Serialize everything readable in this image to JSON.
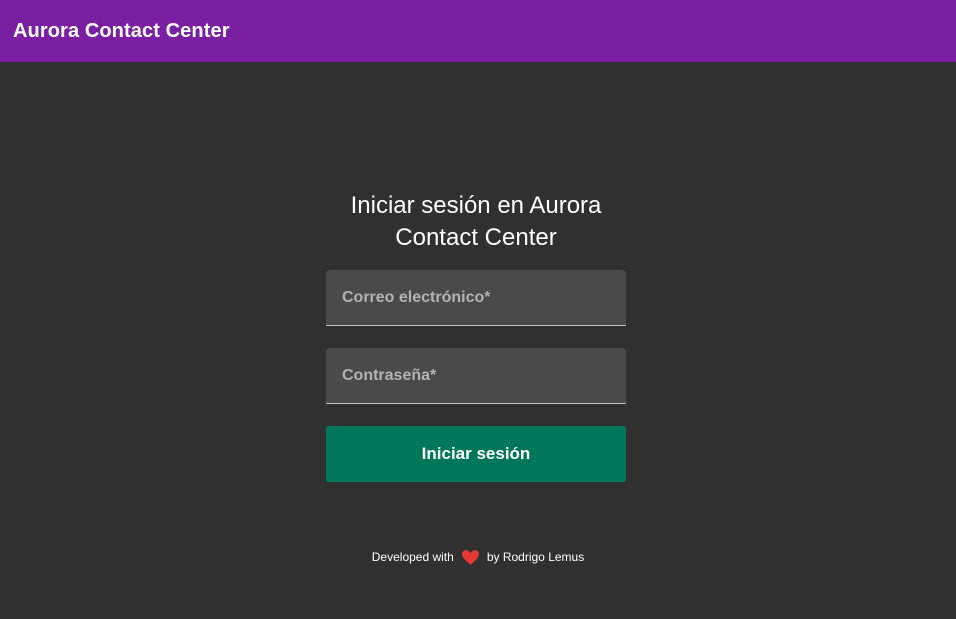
{
  "appbar": {
    "title": "Aurora Contact Center",
    "color": "#7b1fa2"
  },
  "login": {
    "heading_line1": "Iniciar sesión en Aurora",
    "heading_line2": "Contact Center",
    "email": {
      "placeholder": "Correo electrónico*",
      "value": ""
    },
    "password": {
      "placeholder": "Contraseña*",
      "value": ""
    },
    "submit_label": "Iniciar sesión",
    "submit_color": "#00765a"
  },
  "footer": {
    "prefix": "Developed with",
    "icon": "heart-icon",
    "icon_color": "#e53935",
    "suffix": "by Rodrigo Lemus"
  },
  "background_color": "#303030"
}
